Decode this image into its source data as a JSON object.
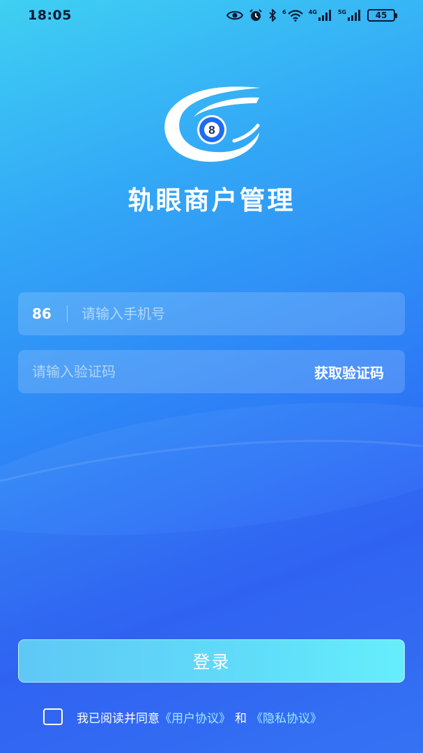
{
  "status_bar": {
    "time": "18:05",
    "net1_label": "4G",
    "net2_label": "5G",
    "wifi_badge": "6",
    "battery": "45",
    "icons": [
      "eye-icon",
      "alarm-icon",
      "bluetooth-icon",
      "wifi-icon",
      "signal-icon",
      "signal-icon",
      "battery-icon"
    ]
  },
  "logo": {
    "badge": "8",
    "icon": "eight-ball-logo-icon"
  },
  "app": {
    "title": "轨眼商户管理"
  },
  "phone": {
    "country_code": "86",
    "placeholder": "请输入手机号",
    "value": ""
  },
  "code": {
    "placeholder": "请输入验证码",
    "value": "",
    "get_code_label": "获取验证码"
  },
  "login": {
    "label": "登录"
  },
  "agreement": {
    "checked": false,
    "prefix": "我已阅读并同意",
    "user_agreement": "《用户协议》",
    "and": "和",
    "privacy": "《隐私协议》"
  },
  "colors": {
    "gradient_top": "#3fd0f2",
    "gradient_mid": "#2d7ff6",
    "gradient_bottom": "#2a5ff5",
    "login_button": "#60dcf9",
    "link": "#9ee9ff"
  }
}
